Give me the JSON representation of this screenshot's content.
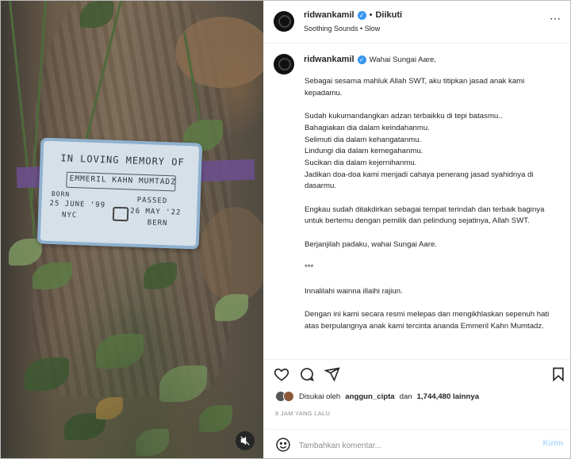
{
  "header": {
    "username": "ridwankamil",
    "separator": "•",
    "follow_status": "Diikuti",
    "audio": "Soothing Sounds • Slow",
    "more_icon": "more-horizontal-icon"
  },
  "photo": {
    "tag_line1": "IN LOVING MEMORY OF",
    "tag_name": "EMMERIL KAHN MUMTADZ",
    "tag_born_label": "BORN",
    "tag_born": "25 JUNE '99",
    "tag_born_place": "NYC",
    "tag_passed_label": "PASSED",
    "tag_passed": "26 MAY '22",
    "tag_passed_place": "BERN",
    "mute_icon": "speaker-muted-icon"
  },
  "caption": {
    "username": "ridwankamil",
    "title": "Wahai Sungai Aare,",
    "paragraphs": [
      "Sebagai sesama mahluk Allah SWT, aku titipkan jasad anak kami kepadamu.",
      "Sudah kukumandangkan adzan terbaikku di tepi batasmu..",
      "Bahagiakan dia dalam keindahanmu.",
      "Selimuti dia dalam kehangatanmu.",
      "Lindungi dia dalam kemegahanmu.",
      "Sucikan dia dalam kejernihanmu.",
      "Jadikan doa-doa kami menjadi cahaya penerang jasad syahidnya di dasarmu.",
      "Engkau sudah ditakdirkan sebagai tempat terindah dan terbaik baginya untuk bertemu dengan pemilik dan pelindung sejatinya, Allah SWT.",
      "Berjanjilah padaku, wahai Sungai Aare.",
      "***",
      "Innalilahi wainna illaihi rajiun.",
      "Dengan ini kami secara resmi melepas dan mengikhlaskan sepenuh hati atas berpulangnya anak kami tercinta ananda Emmeril Kahn Mumtadz."
    ]
  },
  "actions": {
    "like_icon": "heart-icon",
    "comment_icon": "comment-icon",
    "share_icon": "send-icon",
    "save_icon": "bookmark-icon"
  },
  "likes": {
    "prefix": "Disukai oleh",
    "user": "anggun_cipta",
    "connector": "dan",
    "count": "1,744,480 lainnya"
  },
  "timestamp": "8 JAM YANG LALU",
  "comment_box": {
    "emoji_icon": "smiley-icon",
    "placeholder": "Tambahkan komentar...",
    "post_label": "Kirim"
  }
}
